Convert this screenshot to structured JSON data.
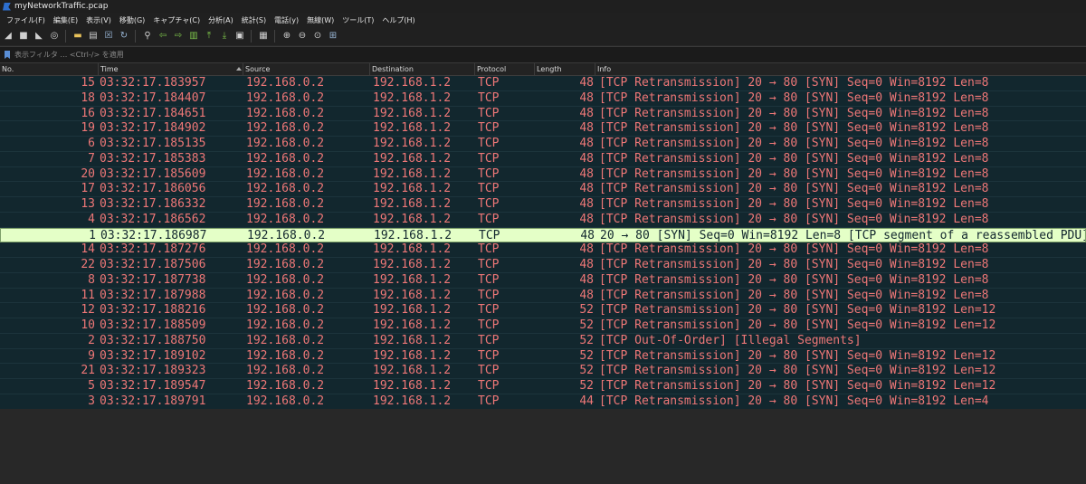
{
  "window": {
    "title": "myNetworkTraffic.pcap"
  },
  "menu": [
    "ファイル(F)",
    "編集(E)",
    "表示(V)",
    "移動(G)",
    "キャプチャ(C)",
    "分析(A)",
    "統計(S)",
    "電話(y)",
    "無線(W)",
    "ツール(T)",
    "ヘルプ(H)"
  ],
  "toolbar_icons": [
    "shark-fin-start-icon",
    "stop-icon",
    "restart-icon",
    "options-gear-icon",
    "sep",
    "open-folder-icon",
    "file-icon",
    "close-file-icon",
    "reload-icon",
    "sep",
    "find-icon",
    "back-arrow-icon",
    "forward-arrow-icon",
    "goto-packet-icon",
    "first-packet-icon",
    "last-packet-icon",
    "autoscroll-icon",
    "sep",
    "colorize-icon",
    "sep",
    "zoom-in-icon",
    "zoom-out-icon",
    "zoom-normal-icon",
    "resize-columns-icon"
  ],
  "filter": {
    "placeholder": "表示フィルタ … <Ctrl-/> を適用"
  },
  "columns": [
    "No.",
    "Time",
    "Source",
    "Destination",
    "Protocol",
    "Length",
    "Info"
  ],
  "packets": [
    {
      "no": "15",
      "time": "03:32:17.183957",
      "src": "192.168.0.2",
      "dst": "192.168.1.2",
      "proto": "TCP",
      "len": "48",
      "info": "[TCP Retransmission] 20 → 80 [SYN] Seq=0 Win=8192 Len=8"
    },
    {
      "no": "18",
      "time": "03:32:17.184407",
      "src": "192.168.0.2",
      "dst": "192.168.1.2",
      "proto": "TCP",
      "len": "48",
      "info": "[TCP Retransmission] 20 → 80 [SYN] Seq=0 Win=8192 Len=8"
    },
    {
      "no": "16",
      "time": "03:32:17.184651",
      "src": "192.168.0.2",
      "dst": "192.168.1.2",
      "proto": "TCP",
      "len": "48",
      "info": "[TCP Retransmission] 20 → 80 [SYN] Seq=0 Win=8192 Len=8"
    },
    {
      "no": "19",
      "time": "03:32:17.184902",
      "src": "192.168.0.2",
      "dst": "192.168.1.2",
      "proto": "TCP",
      "len": "48",
      "info": "[TCP Retransmission] 20 → 80 [SYN] Seq=0 Win=8192 Len=8"
    },
    {
      "no": "6",
      "time": "03:32:17.185135",
      "src": "192.168.0.2",
      "dst": "192.168.1.2",
      "proto": "TCP",
      "len": "48",
      "info": "[TCP Retransmission] 20 → 80 [SYN] Seq=0 Win=8192 Len=8"
    },
    {
      "no": "7",
      "time": "03:32:17.185383",
      "src": "192.168.0.2",
      "dst": "192.168.1.2",
      "proto": "TCP",
      "len": "48",
      "info": "[TCP Retransmission] 20 → 80 [SYN] Seq=0 Win=8192 Len=8"
    },
    {
      "no": "20",
      "time": "03:32:17.185609",
      "src": "192.168.0.2",
      "dst": "192.168.1.2",
      "proto": "TCP",
      "len": "48",
      "info": "[TCP Retransmission] 20 → 80 [SYN] Seq=0 Win=8192 Len=8"
    },
    {
      "no": "17",
      "time": "03:32:17.186056",
      "src": "192.168.0.2",
      "dst": "192.168.1.2",
      "proto": "TCP",
      "len": "48",
      "info": "[TCP Retransmission] 20 → 80 [SYN] Seq=0 Win=8192 Len=8"
    },
    {
      "no": "13",
      "time": "03:32:17.186332",
      "src": "192.168.0.2",
      "dst": "192.168.1.2",
      "proto": "TCP",
      "len": "48",
      "info": "[TCP Retransmission] 20 → 80 [SYN] Seq=0 Win=8192 Len=8"
    },
    {
      "no": "4",
      "time": "03:32:17.186562",
      "src": "192.168.0.2",
      "dst": "192.168.1.2",
      "proto": "TCP",
      "len": "48",
      "info": "[TCP Retransmission] 20 → 80 [SYN] Seq=0 Win=8192 Len=8"
    },
    {
      "no": "1",
      "time": "03:32:17.186987",
      "src": "192.168.0.2",
      "dst": "192.168.1.2",
      "proto": "TCP",
      "len": "48",
      "info": "20 → 80 [SYN] Seq=0 Win=8192 Len=8 [TCP segment of a reassembled PDU]",
      "selected": true
    },
    {
      "no": "14",
      "time": "03:32:17.187276",
      "src": "192.168.0.2",
      "dst": "192.168.1.2",
      "proto": "TCP",
      "len": "48",
      "info": "[TCP Retransmission] 20 → 80 [SYN] Seq=0 Win=8192 Len=8"
    },
    {
      "no": "22",
      "time": "03:32:17.187506",
      "src": "192.168.0.2",
      "dst": "192.168.1.2",
      "proto": "TCP",
      "len": "48",
      "info": "[TCP Retransmission] 20 → 80 [SYN] Seq=0 Win=8192 Len=8"
    },
    {
      "no": "8",
      "time": "03:32:17.187738",
      "src": "192.168.0.2",
      "dst": "192.168.1.2",
      "proto": "TCP",
      "len": "48",
      "info": "[TCP Retransmission] 20 → 80 [SYN] Seq=0 Win=8192 Len=8"
    },
    {
      "no": "11",
      "time": "03:32:17.187988",
      "src": "192.168.0.2",
      "dst": "192.168.1.2",
      "proto": "TCP",
      "len": "48",
      "info": "[TCP Retransmission] 20 → 80 [SYN] Seq=0 Win=8192 Len=8"
    },
    {
      "no": "12",
      "time": "03:32:17.188216",
      "src": "192.168.0.2",
      "dst": "192.168.1.2",
      "proto": "TCP",
      "len": "52",
      "info": "[TCP Retransmission] 20 → 80 [SYN] Seq=0 Win=8192 Len=12"
    },
    {
      "no": "10",
      "time": "03:32:17.188509",
      "src": "192.168.0.2",
      "dst": "192.168.1.2",
      "proto": "TCP",
      "len": "52",
      "info": "[TCP Retransmission] 20 → 80 [SYN] Seq=0 Win=8192 Len=12"
    },
    {
      "no": "2",
      "time": "03:32:17.188750",
      "src": "192.168.0.2",
      "dst": "192.168.1.2",
      "proto": "TCP",
      "len": "52",
      "info": "[TCP Out-Of-Order] [Illegal Segments]"
    },
    {
      "no": "9",
      "time": "03:32:17.189102",
      "src": "192.168.0.2",
      "dst": "192.168.1.2",
      "proto": "TCP",
      "len": "52",
      "info": "[TCP Retransmission] 20 → 80 [SYN] Seq=0 Win=8192 Len=12"
    },
    {
      "no": "21",
      "time": "03:32:17.189323",
      "src": "192.168.0.2",
      "dst": "192.168.1.2",
      "proto": "TCP",
      "len": "52",
      "info": "[TCP Retransmission] 20 → 80 [SYN] Seq=0 Win=8192 Len=12"
    },
    {
      "no": "5",
      "time": "03:32:17.189547",
      "src": "192.168.0.2",
      "dst": "192.168.1.2",
      "proto": "TCP",
      "len": "52",
      "info": "[TCP Retransmission] 20 → 80 [SYN] Seq=0 Win=8192 Len=12"
    },
    {
      "no": "3",
      "time": "03:32:17.189791",
      "src": "192.168.0.2",
      "dst": "192.168.1.2",
      "proto": "TCP",
      "len": "44",
      "info": "[TCP Retransmission] 20 → 80 [SYN] Seq=0 Win=8192 Len=4"
    }
  ],
  "colors": {
    "row_bg": "#12272e",
    "row_fg": "#ee7777",
    "selected_bg": "#e4ffc7",
    "selected_fg": "#12272e"
  }
}
